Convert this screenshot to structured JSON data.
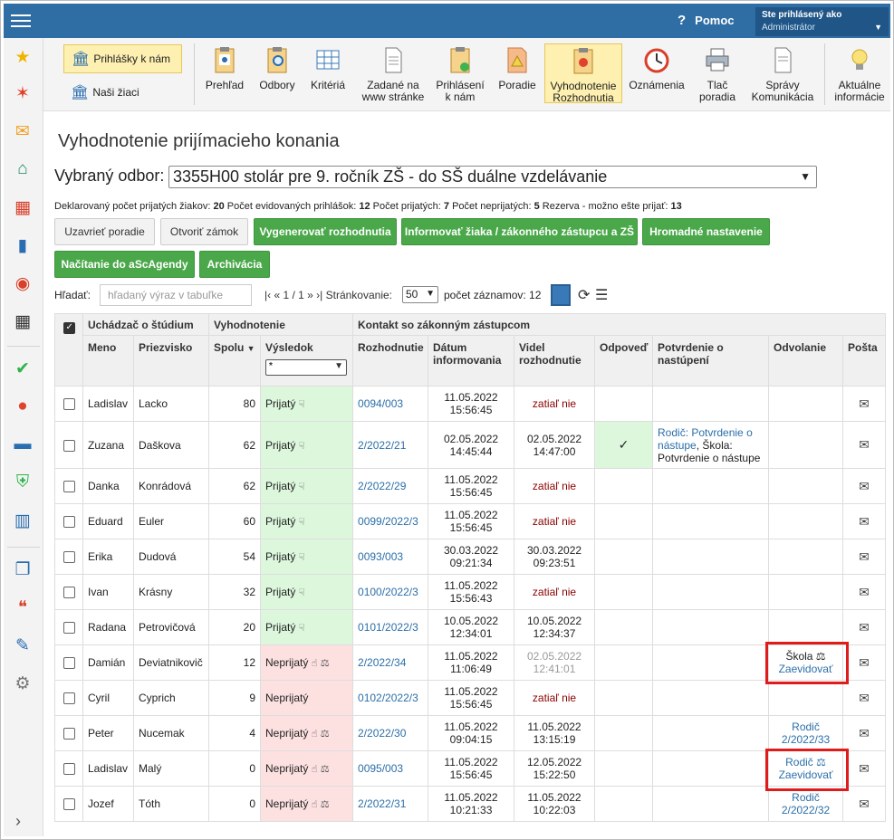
{
  "topbar": {
    "help_label": "Pomoc",
    "user_line1": "Ste prihlásený ako",
    "user_line2": "Administrátor"
  },
  "toolbar": {
    "left_buttons": [
      "Prihlášky k nám",
      "Naši žiaci"
    ],
    "items": [
      "Prehľad",
      "Odbory",
      "Kritériá",
      "Zadané na www stránke",
      "Prihlásení k nám",
      "Poradie",
      "Vyhodnotenie Rozhodnutia",
      "Oznámenia",
      "Tlač poradia",
      "Správy Komunikácia",
      "Aktuálne informácie"
    ]
  },
  "page": {
    "title": "Vyhodnotenie prijímacieho konania",
    "odbor_label": "Vybraný odbor:",
    "odbor_value": "3355H00 stolár pre 9. ročník ZŠ - do SŠ duálne vzdelávanie"
  },
  "stats": {
    "declared_label": "Deklarovaný počet prijatých žiakov:",
    "declared": "20",
    "registered_label": "Počet evidovaných prihlášok:",
    "registered": "12",
    "accepted_label": "Počet prijatých:",
    "accepted": "7",
    "rejected_label": "Počet neprijatých:",
    "rejected": "5",
    "reserve_label": "Rezerva - možno ešte prijať:",
    "reserve": "13"
  },
  "buttons": {
    "close_order": "Uzavrieť poradie",
    "open_lock": "Otvoriť zámok",
    "generate": "Vygenerovať rozhodnutia",
    "inform": "Informovať žiaka / zákonného zástupcu a ZŠ",
    "bulk": "Hromadné nastavenie",
    "load_asc": "Načítanie do aScAgendy",
    "archive": "Archivácia"
  },
  "search": {
    "label": "Hľadať:",
    "placeholder": "hľadaný výraz v tabuľke",
    "pager": "|‹ « 1 / 1 » ›|",
    "paging_label": "Stránkovanie:",
    "page_size": "50",
    "count_label": "počet záznamov: 12"
  },
  "table": {
    "group_headers": [
      "Uchádzač o štúdium",
      "Vyhodnotenie",
      "Kontakt so zákonným zástupcom"
    ],
    "headers": [
      "Meno",
      "Priezvisko",
      "Spolu",
      "Výsledok",
      "Rozhodnutie",
      "Dátum informovania",
      "Videl rozhodnutie",
      "Odpoveď",
      "Potvrdenie o nastúpení",
      "Odvolanie",
      "Pošta"
    ],
    "result_filter": "*",
    "sort_arrow": "▼",
    "rows": [
      {
        "meno": "Ladislav",
        "priezvisko": "Lacko",
        "spolu": "80",
        "vysledok": "Prijatý",
        "ok": true,
        "rozh": "0094/003",
        "dat1": "11.05.2022",
        "dat2": "15:56:45",
        "videl1": "zatiaľ nie",
        "videl2": "",
        "videl_style": "red",
        "odp": "",
        "potvr": "",
        "odv1": "",
        "odv2": ""
      },
      {
        "meno": "Zuzana",
        "priezvisko": "Daškova",
        "spolu": "62",
        "vysledok": "Prijatý",
        "ok": true,
        "rozh": "2/2022/21",
        "dat1": "02.05.2022",
        "dat2": "14:45:44",
        "videl1": "02.05.2022",
        "videl2": "14:47:00",
        "videl_style": "",
        "odp": "✓",
        "potvr_link": "Rodič: Potvrdenie o nástupe",
        "potvr_rest": ", Škola: Potvrdenie o nástupe",
        "odv1": "",
        "odv2": ""
      },
      {
        "meno": "Danka",
        "priezvisko": "Konrádová",
        "spolu": "62",
        "vysledok": "Prijatý",
        "ok": true,
        "rozh": "2/2022/29",
        "dat1": "11.05.2022",
        "dat2": "15:56:45",
        "videl1": "zatiaľ nie",
        "videl2": "",
        "videl_style": "red",
        "odp": "",
        "potvr": "",
        "odv1": "",
        "odv2": ""
      },
      {
        "meno": "Eduard",
        "priezvisko": "Euler",
        "spolu": "60",
        "vysledok": "Prijatý",
        "ok": true,
        "rozh": "0099/2022/3",
        "dat1": "11.05.2022",
        "dat2": "15:56:45",
        "videl1": "zatiaľ nie",
        "videl2": "",
        "videl_style": "red",
        "odp": "",
        "potvr": "",
        "odv1": "",
        "odv2": ""
      },
      {
        "meno": "Erika",
        "priezvisko": "Dudová",
        "spolu": "54",
        "vysledok": "Prijatý",
        "ok": true,
        "rozh": "0093/003",
        "dat1": "30.03.2022",
        "dat2": "09:21:34",
        "videl1": "30.03.2022",
        "videl2": "09:23:51",
        "videl_style": "",
        "odp": "",
        "potvr": "",
        "odv1": "",
        "odv2": ""
      },
      {
        "meno": "Ivan",
        "priezvisko": "Krásny",
        "spolu": "32",
        "vysledok": "Prijatý",
        "ok": true,
        "rozh": "0100/2022/3",
        "dat1": "11.05.2022",
        "dat2": "15:56:43",
        "videl1": "zatiaľ nie",
        "videl2": "",
        "videl_style": "red",
        "odp": "",
        "potvr": "",
        "odv1": "",
        "odv2": ""
      },
      {
        "meno": "Radana",
        "priezvisko": "Petrovičová",
        "spolu": "20",
        "vysledok": "Prijatý",
        "ok": true,
        "rozh": "0101/2022/3",
        "dat1": "10.05.2022",
        "dat2": "12:34:01",
        "videl1": "10.05.2022",
        "videl2": "12:34:37",
        "videl_style": "",
        "odp": "",
        "potvr": "",
        "odv1": "",
        "odv2": ""
      },
      {
        "meno": "Damián",
        "priezvisko": "Deviatnikovič",
        "spolu": "12",
        "vysledok": "Neprijatý",
        "ok": false,
        "rozh": "2/2022/34",
        "dat1": "11.05.2022",
        "dat2": "11:06:49",
        "videl1": "02.05.2022",
        "videl2": "12:41:01",
        "videl_style": "gray",
        "odp": "",
        "potvr": "",
        "odv1": "Škola ⚖",
        "odv2": "Zaevidovať",
        "odv1_plain": true
      },
      {
        "meno": "Cyril",
        "priezvisko": "Cyprich",
        "spolu": "9",
        "vysledok": "Neprijatý",
        "ok": false,
        "rozh": "0102/2022/3",
        "dat1": "11.05.2022",
        "dat2": "15:56:45",
        "videl1": "zatiaľ nie",
        "videl2": "",
        "videl_style": "red",
        "odp": "",
        "potvr": "",
        "odv1": "",
        "odv2": "",
        "no_icons": true
      },
      {
        "meno": "Peter",
        "priezvisko": "Nucemak",
        "spolu": "4",
        "vysledok": "Neprijatý",
        "ok": false,
        "rozh": "2/2022/30",
        "dat1": "11.05.2022",
        "dat2": "09:04:15",
        "videl1": "11.05.2022",
        "videl2": "13:15:19",
        "videl_style": "",
        "odp": "",
        "potvr": "",
        "odv1": "Rodič",
        "odv2": "2/2022/33"
      },
      {
        "meno": "Ladislav",
        "priezvisko": "Malý",
        "spolu": "0",
        "vysledok": "Neprijatý",
        "ok": false,
        "rozh": "0095/003",
        "dat1": "11.05.2022",
        "dat2": "15:56:45",
        "videl1": "12.05.2022",
        "videl2": "15:22:50",
        "videl_style": "",
        "odp": "",
        "potvr": "",
        "odv1": "Rodič ⚖",
        "odv2": "Zaevidovať"
      },
      {
        "meno": "Jozef",
        "priezvisko": "Tóth",
        "spolu": "0",
        "vysledok": "Neprijatý",
        "ok": false,
        "rozh": "2/2022/31",
        "dat1": "11.05.2022",
        "dat2": "10:21:33",
        "videl1": "11.05.2022",
        "videl2": "10:22:03",
        "videl_style": "",
        "odp": "",
        "potvr": "",
        "odv1": "Rodič",
        "odv2": "2/2022/32"
      }
    ]
  }
}
